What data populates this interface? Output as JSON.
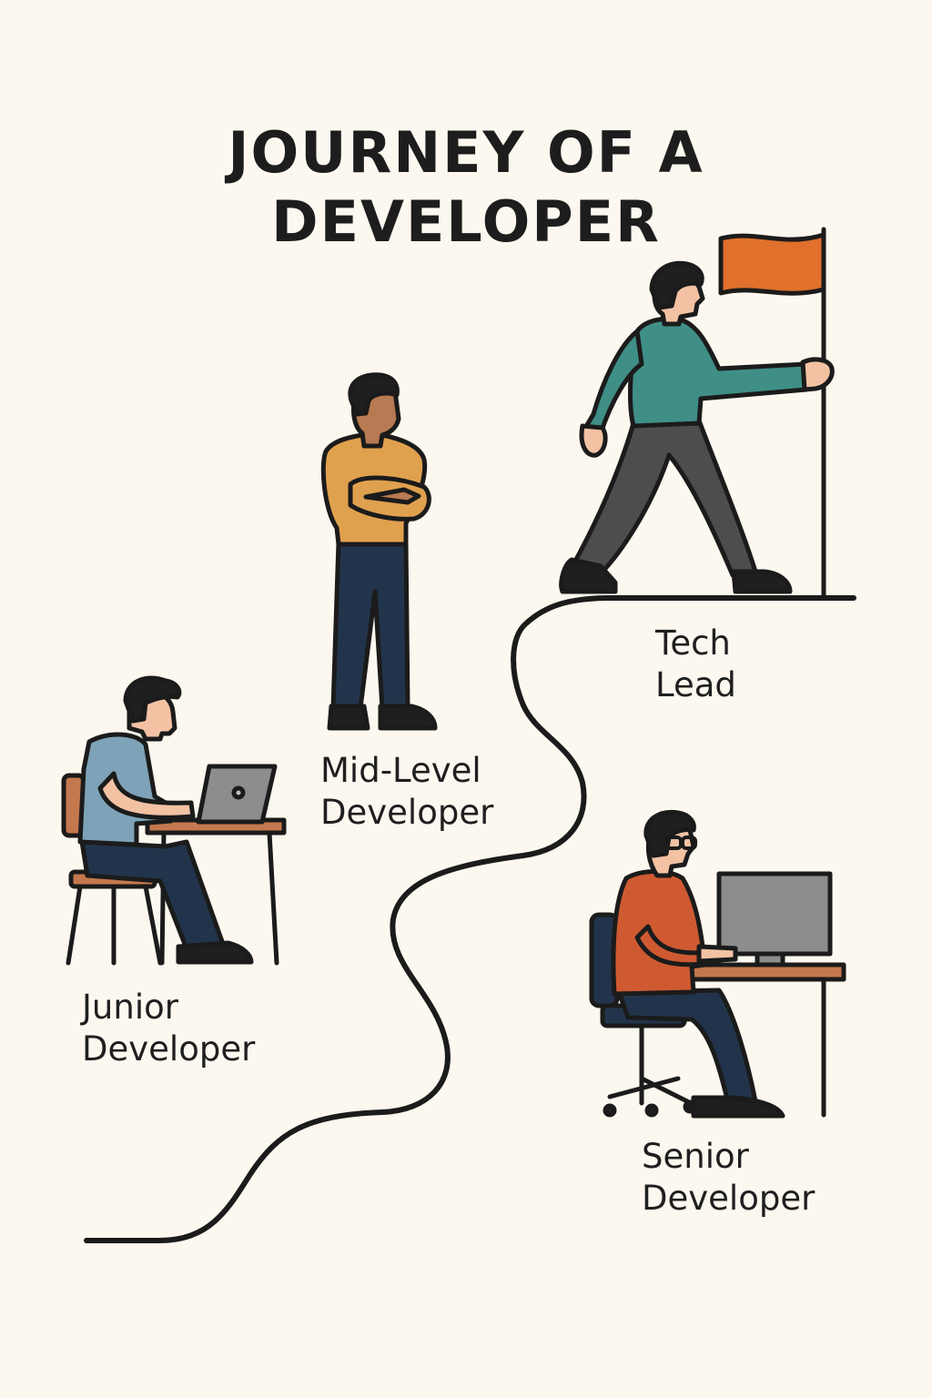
{
  "title": {
    "line1": "JOURNEY OF A",
    "line2": "DEVELOPER"
  },
  "stages": [
    {
      "line1": "Junior",
      "line2": "Developer"
    },
    {
      "line1": "Mid-Level",
      "line2": "Developer"
    },
    {
      "line1": "Tech",
      "line2": "Lead"
    },
    {
      "line1": "Senior",
      "line2": "Developer"
    }
  ],
  "colors": {
    "background": "#fcf8ef",
    "outline": "#1b1b1b",
    "flag": "#e0702c",
    "junior_shirt": "#7ea3b8",
    "mid_shirt": "#e0a14e",
    "lead_shirt": "#3f8f86",
    "senior_shirt": "#cf5a32",
    "pants_navy": "#22344b",
    "pants_gray": "#4d4d4d",
    "skin": "#f2c2a3",
    "skin_dark": "#b77a52",
    "wood": "#c4784d"
  }
}
